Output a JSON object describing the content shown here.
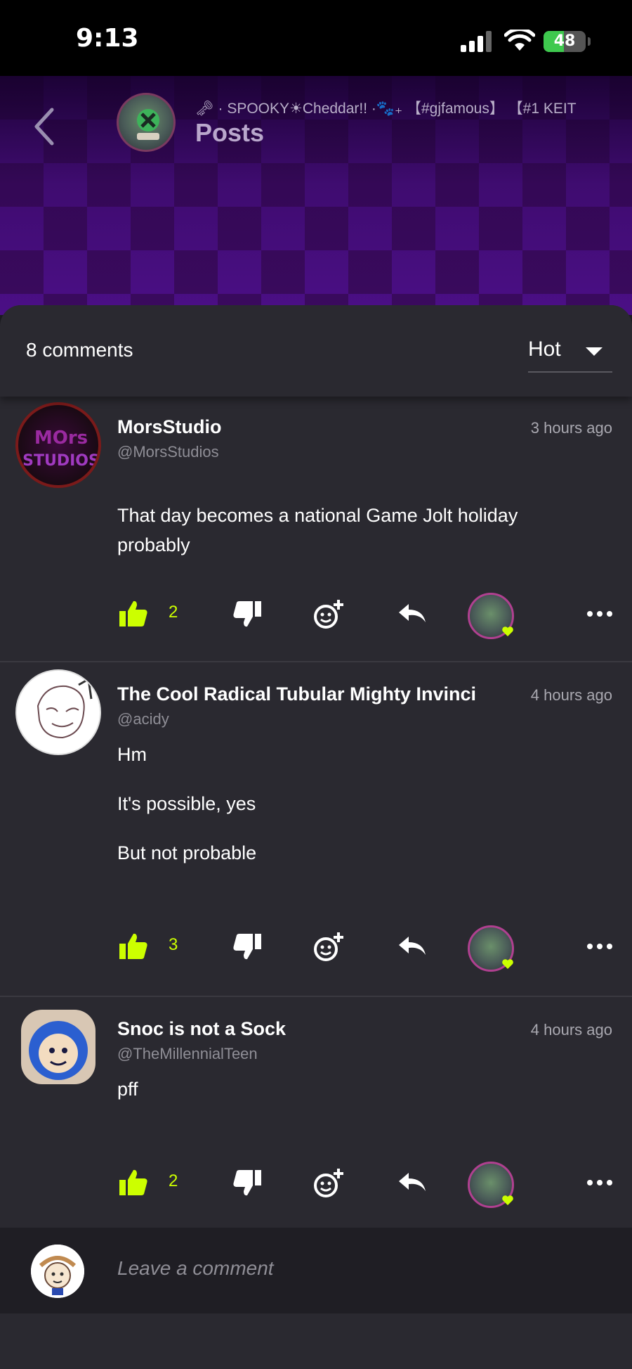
{
  "status_bar": {
    "time": "9:13",
    "battery": "48",
    "battery_level": 0.48
  },
  "header": {
    "subtitle": "🗝 · SPOOKY☀Cheddar!! ·🐾₊ 【#gjfamous】 【#1 KEIT",
    "title": "Posts"
  },
  "sheet": {
    "comments_count": "8 comments",
    "sort": "Hot"
  },
  "comments": [
    {
      "author": "MorsStudio",
      "handle": "@MorsStudios",
      "time": "3 hours ago",
      "lines": [
        "That day becomes a national Game Jolt holiday",
        "probably"
      ],
      "likes": "2"
    },
    {
      "author": "The Cool Radical Tubular Mighty Invinci",
      "handle": "@acidy",
      "time": "4 hours ago",
      "lines": [
        "Hm",
        "It's possible, yes",
        "But not probable"
      ],
      "likes": "3"
    },
    {
      "author": "Snoc is not a Sock",
      "handle": "@TheMillennialTeen",
      "time": "4 hours ago",
      "lines": [
        "pff"
      ],
      "likes": "2"
    }
  ],
  "footer": {
    "placeholder": "Leave a comment"
  },
  "colors": {
    "accent": "#ccff00",
    "sheet_bg": "#2a2930",
    "header_purple": "#4b0f86"
  }
}
